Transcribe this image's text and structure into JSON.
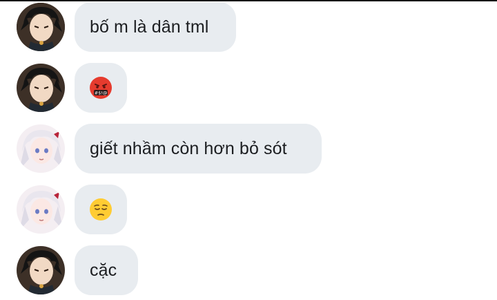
{
  "messages": [
    {
      "sender": "dark-haired-user",
      "type": "text",
      "text": "bố m là dân tml"
    },
    {
      "sender": "dark-haired-user",
      "type": "emoji",
      "emoji": "face-with-symbols-on-mouth-icon"
    },
    {
      "sender": "white-haired-user",
      "type": "text",
      "text": "giết nhầm còn hơn bỏ sót"
    },
    {
      "sender": "white-haired-user",
      "type": "emoji",
      "emoji": "pensive-face-icon"
    },
    {
      "sender": "dark-haired-user",
      "type": "text",
      "text": "cặc"
    }
  ],
  "colors": {
    "bubble_bg": "#e8ecf0",
    "text": "#1c1e21",
    "emoji_yellow": "#ffcc33",
    "emoji_red": "#e63b2e"
  }
}
